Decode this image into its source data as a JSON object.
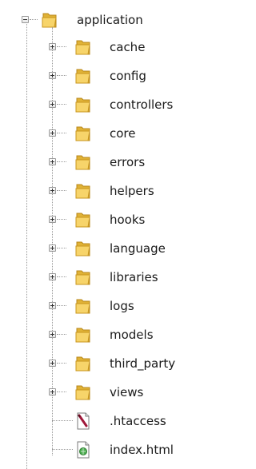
{
  "tree": {
    "root": {
      "label": "application",
      "expanded": true,
      "icon": "folder-icon"
    },
    "folders": [
      {
        "label": "cache",
        "icon": "folder-icon"
      },
      {
        "label": "config",
        "icon": "folder-icon"
      },
      {
        "label": "controllers",
        "icon": "folder-icon"
      },
      {
        "label": "core",
        "icon": "folder-icon"
      },
      {
        "label": "errors",
        "icon": "folder-icon"
      },
      {
        "label": "helpers",
        "icon": "folder-icon"
      },
      {
        "label": "hooks",
        "icon": "folder-icon"
      },
      {
        "label": "language",
        "icon": "folder-icon"
      },
      {
        "label": "libraries",
        "icon": "folder-icon"
      },
      {
        "label": "logs",
        "icon": "folder-icon"
      },
      {
        "label": "models",
        "icon": "folder-icon"
      },
      {
        "label": "third_party",
        "icon": "folder-icon"
      },
      {
        "label": "views",
        "icon": "folder-icon"
      }
    ],
    "files": [
      {
        "label": ".htaccess",
        "icon": "htaccess-file-icon"
      },
      {
        "label": "index.html",
        "icon": "html-file-icon"
      }
    ],
    "colors": {
      "folder_yellow": "#f5c542",
      "folder_dark": "#d9a520",
      "text": "#1a1a1a",
      "connector": "#9a9a9a"
    }
  }
}
